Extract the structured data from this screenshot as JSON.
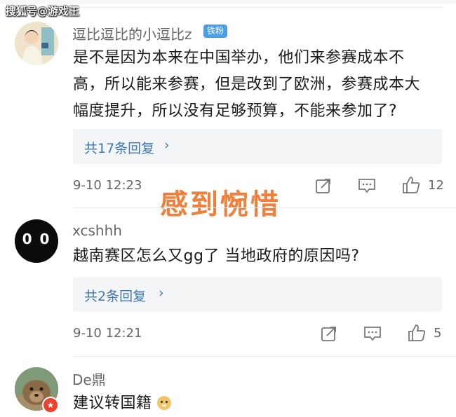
{
  "watermark": "搜狐号@游戏王",
  "overlay_caption": "感到惋惜",
  "comments": [
    {
      "username": "逗比逗比的小逗比z",
      "badge": "铁粉",
      "text_lines": [
        "是不是因为本来在中国举办，他们来参赛成本不",
        "高，所以能来参赛，但是改到了欧洲，参赛成本大",
        "幅度提升，所以没有足够预算，不能来参加了?"
      ],
      "reply_summary": "共17条回复",
      "time": "9-10 12:23",
      "like_count": "12",
      "avatar_icon": "illustrated-person-avatar"
    },
    {
      "username": "xcshhh",
      "avatar_text": "0 0",
      "text_lines": [
        "越南赛区怎么又gg了 当地政府的原因吗?"
      ],
      "reply_summary": "共2条回复",
      "time": "9-10 12:21",
      "like_count": "5"
    },
    {
      "username": "De鼎",
      "text_lines": [
        "建议转国籍"
      ],
      "emoji_icon": "doge-emoji",
      "avatar_icon": "quokka-photo-avatar"
    }
  ],
  "actions": {
    "share_icon": "share-icon",
    "comment_icon": "comment-icon",
    "like_icon": "thumbs-up-icon"
  },
  "colors": {
    "reply_link": "#3f78b8",
    "badge": "#4a9ee8",
    "overlay_caption": "#ef7f3a"
  }
}
